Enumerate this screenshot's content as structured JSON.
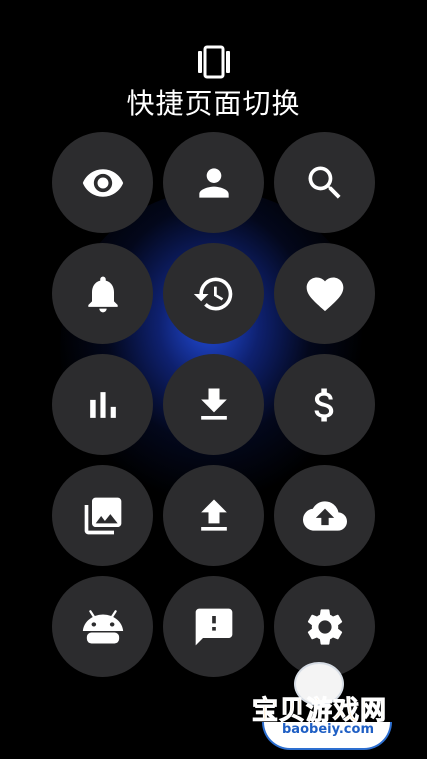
{
  "header": {
    "title": "快捷页面切换",
    "icon": "view-carousel-icon"
  },
  "tiles": [
    {
      "name": "eye-tile",
      "icon": "eye-icon"
    },
    {
      "name": "person-tile",
      "icon": "person-icon"
    },
    {
      "name": "search-tile",
      "icon": "search-icon"
    },
    {
      "name": "bell-tile",
      "icon": "bell-icon"
    },
    {
      "name": "history-tile",
      "icon": "history-icon"
    },
    {
      "name": "heart-tile",
      "icon": "heart-icon"
    },
    {
      "name": "bar-chart-tile",
      "icon": "bar-chart-icon"
    },
    {
      "name": "download-tile",
      "icon": "download-icon"
    },
    {
      "name": "dollar-tile",
      "icon": "dollar-icon"
    },
    {
      "name": "photo-library-tile",
      "icon": "photo-library-icon"
    },
    {
      "name": "upload-tile",
      "icon": "upload-icon"
    },
    {
      "name": "cloud-upload-tile",
      "icon": "cloud-upload-icon"
    },
    {
      "name": "android-tile",
      "icon": "android-icon"
    },
    {
      "name": "feedback-tile",
      "icon": "feedback-icon"
    },
    {
      "name": "settings-tile",
      "icon": "gear-icon"
    }
  ],
  "watermark": {
    "brand": "宝贝游戏网",
    "url": "baobeiy.com"
  },
  "colors": {
    "background": "#000000",
    "tile": "#2c2c2e",
    "glow": "#2350e6",
    "icon": "#ffffff"
  }
}
